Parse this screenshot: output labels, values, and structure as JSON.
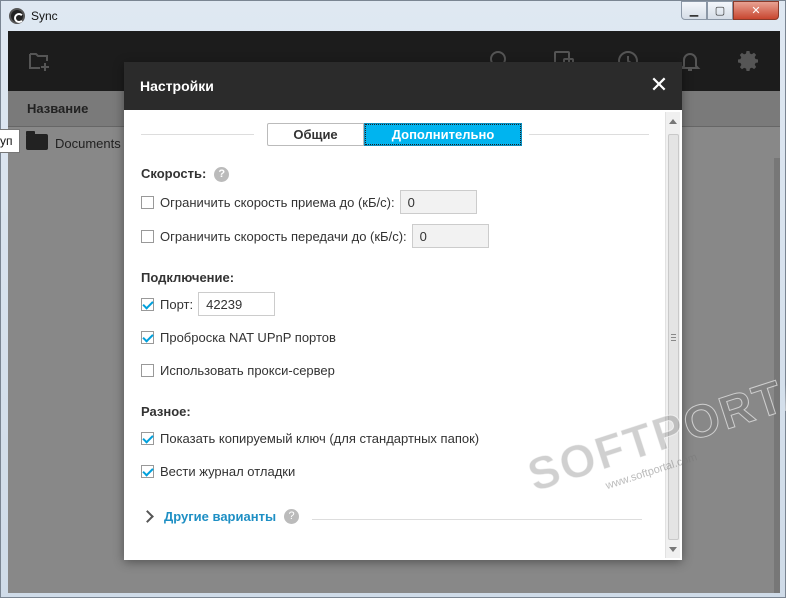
{
  "window": {
    "title": "Sync",
    "min_glyph": "▁",
    "max_glyph": "▢",
    "close_glyph": "✕"
  },
  "toolbar": {
    "icons": [
      "add-folder-icon",
      "search-icon",
      "device-icon",
      "history-icon",
      "bell-icon",
      "gear-icon"
    ]
  },
  "filelist": {
    "column_name": "Название",
    "rows": [
      {
        "name": "Documents"
      }
    ],
    "tooltip": "уп"
  },
  "dialog": {
    "title": "Настройки",
    "close_glyph": "✕",
    "tabs": {
      "general": "Общие",
      "advanced": "Дополнительно"
    },
    "speed": {
      "heading": "Скорость:",
      "help": "?",
      "limit_download": {
        "label": "Ограничить скорость приема до (кБ/с):",
        "checked": false,
        "value": "0"
      },
      "limit_upload": {
        "label": "Ограничить скорость передачи до (кБ/с):",
        "checked": false,
        "value": "0"
      }
    },
    "connection": {
      "heading": "Подключение:",
      "port": {
        "label": "Порт:",
        "checked": true,
        "value": "42239"
      },
      "nat": {
        "label": "Проброска NAT UPnP портов",
        "checked": true
      },
      "proxy": {
        "label": "Использовать прокси-сервер",
        "checked": false
      }
    },
    "misc": {
      "heading": "Разное:",
      "show_key": {
        "label": "Показать копируемый ключ (для стандартных папок)",
        "checked": true
      },
      "debug_log": {
        "label": "Вести журнал отладки",
        "checked": true
      }
    },
    "more": {
      "label": "Другие варианты",
      "help": "?"
    }
  },
  "watermark": {
    "text": "SOFTPORTAL",
    "tm": "™",
    "url": "www.softportal.com"
  },
  "colors": {
    "accent": "#00b4ef",
    "link": "#1e8fc4",
    "header": "#2b2b2b"
  }
}
